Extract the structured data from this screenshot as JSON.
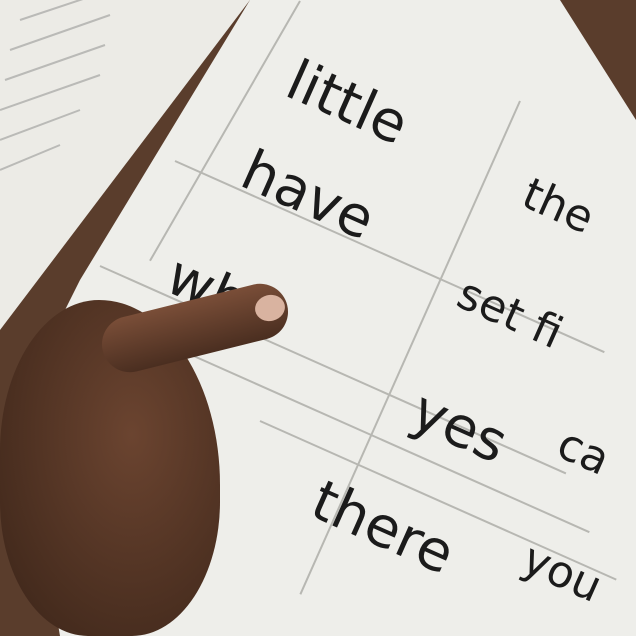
{
  "words": [
    "little",
    "have",
    "who",
    "the",
    "set fi",
    "yes",
    "ca",
    "there",
    "you"
  ],
  "colors": {
    "page": "#eeeeea",
    "ink": "#1b1b1b",
    "skin": "#6b4430"
  }
}
